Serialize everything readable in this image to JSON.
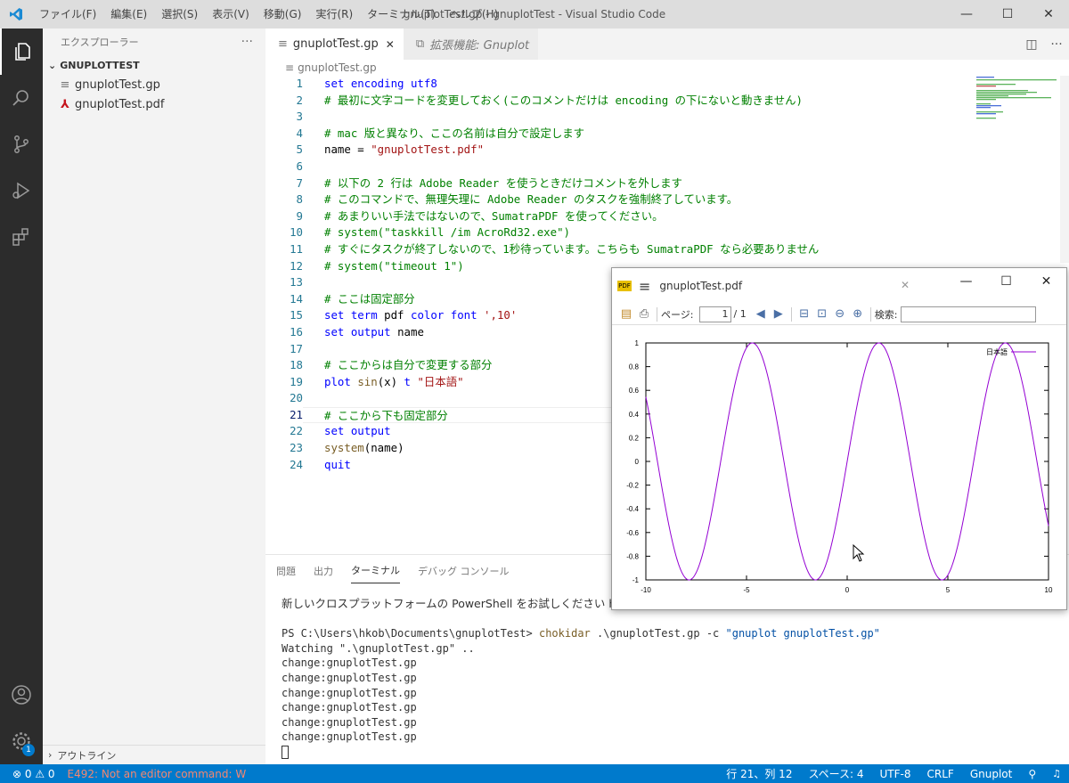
{
  "window": {
    "title": "gnuplotTest.gp - gnuplotTest - Visual Studio Code",
    "menu": [
      "ファイル(F)",
      "編集(E)",
      "選択(S)",
      "表示(V)",
      "移動(G)",
      "実行(R)",
      "ターミナル(T)",
      "ヘルプ(H)"
    ],
    "controls": {
      "minimize": "—",
      "maximize": "☐",
      "close": "✕"
    }
  },
  "activity": {
    "icons": [
      "files-icon",
      "search-icon",
      "source-control-icon",
      "run-debug-icon",
      "extensions-icon",
      "account-icon",
      "settings-gear-icon"
    ],
    "badge": "1"
  },
  "sidebar": {
    "title": "エクスプローラー",
    "more": "···",
    "folder": "GNUPLOTTEST",
    "files": [
      {
        "name": "gnuplotTest.gp",
        "icon": "≡"
      },
      {
        "name": "gnuplotTest.pdf",
        "icon": "⅄"
      }
    ],
    "outline": "アウトライン"
  },
  "tabs": [
    {
      "label": "gnuplotTest.gp",
      "close": "✕",
      "icon": "≡"
    },
    {
      "label": "拡張機能: Gnuplot",
      "icon": "⧉"
    }
  ],
  "breadcrumb": "gnuplotTest.gp",
  "code": {
    "current_line": 21,
    "lines": [
      [
        [
          "kw",
          "set encoding utf8"
        ]
      ],
      [
        [
          "cm",
          "# 最初に文字コードを変更しておく(このコメントだけは encoding の下にないと動きません)"
        ]
      ],
      [],
      [
        [
          "cm",
          "# mac 版と異なり、ここの名前は自分で設定します"
        ]
      ],
      [
        [
          "tx",
          "name = "
        ],
        [
          "st",
          "\"gnuplotTest.pdf\""
        ]
      ],
      [],
      [
        [
          "cm",
          "# 以下の 2 行は Adobe Reader を使うときだけコメントを外します"
        ]
      ],
      [
        [
          "cm",
          "# このコマンドで、無理矢理に Adobe Reader のタスクを強制終了しています。"
        ]
      ],
      [
        [
          "cm",
          "# あまりいい手法ではないので、SumatraPDF を使ってください。"
        ]
      ],
      [
        [
          "cm",
          "# system(\"taskkill /im AcroRd32.exe\")"
        ]
      ],
      [
        [
          "cm",
          "# すぐにタスクが終了しないので、1秒待っています。こちらも SumatraPDF なら必要ありません"
        ]
      ],
      [
        [
          "cm",
          "# system(\"timeout 1\")"
        ]
      ],
      [],
      [
        [
          "cm",
          "# ここは固定部分"
        ]
      ],
      [
        [
          "kw",
          "set term "
        ],
        [
          "tx",
          "pdf "
        ],
        [
          "kw",
          "color font "
        ],
        [
          "st",
          "',10'"
        ]
      ],
      [
        [
          "kw",
          "set output "
        ],
        [
          "tx",
          "name"
        ]
      ],
      [],
      [
        [
          "cm",
          "# ここからは自分で変更する部分"
        ]
      ],
      [
        [
          "kw",
          "plot "
        ],
        [
          "fn",
          "sin"
        ],
        [
          "tx",
          "(x) "
        ],
        [
          "kw",
          "t "
        ],
        [
          "st",
          "\"日本語\""
        ]
      ],
      [],
      [
        [
          "cm",
          "# ここから下も固定部分"
        ]
      ],
      [
        [
          "kw",
          "set output"
        ]
      ],
      [
        [
          "fn",
          "system"
        ],
        [
          "tx",
          "(name)"
        ]
      ],
      [
        [
          "kw",
          "quit"
        ]
      ]
    ]
  },
  "panel": {
    "tabs": [
      "問題",
      "出力",
      "ターミナル",
      "デバッグ コンソール"
    ],
    "active_tab": 2,
    "terminal": {
      "line1": "新しいクロスプラットフォームの PowerShell をお試しください https://aka.ms/pscore6",
      "prompt": "PS C:\\Users\\hkob\\Documents\\gnuplotTest> ",
      "cmd": "chokidar",
      "args": " .\\gnuplotTest.gp -c ",
      "str": "\"gnuplot gnuplotTest.gp\"",
      "watching": "Watching \".\\gnuplotTest.gp\" ..",
      "changes": [
        "change:gnuplotTest.gp",
        "change:gnuplotTest.gp",
        "change:gnuplotTest.gp",
        "change:gnuplotTest.gp",
        "change:gnuplotTest.gp",
        "change:gnuplotTest.gp"
      ]
    }
  },
  "statusbar": {
    "errors": "⊗ 0 ⚠ 0",
    "message": "E492: Not an editor command: W",
    "position": "行 21、列 12",
    "spaces": "スペース: 4",
    "encoding": "UTF-8",
    "eol": "CRLF",
    "language": "Gnuplot",
    "feedback_icon": "⚲",
    "bell_icon": "🔔"
  },
  "pdf_viewer": {
    "title": "gnuplotTest.pdf",
    "logo": "PDF",
    "menu": "≡",
    "tab_close": "✕",
    "controls": {
      "minimize": "—",
      "maximize": "☐",
      "close": "✕"
    },
    "page_label": "ページ:",
    "page_value": "1",
    "page_total": "/ 1",
    "search_label": "検索:"
  },
  "chart_data": {
    "type": "line",
    "series": [
      {
        "name": "日本語",
        "function": "sin(x)",
        "color": "#9400d3"
      }
    ],
    "xlim": [
      -10,
      10
    ],
    "ylim": [
      -1,
      1
    ],
    "xticks": [
      "-10",
      "-5",
      "0",
      "5",
      "10"
    ],
    "yticks": [
      "1",
      "0.8",
      "0.6",
      "0.4",
      "0.2",
      "0",
      "-0.2",
      "-0.4",
      "-0.6",
      "-0.8",
      "-1"
    ],
    "legend_placement": "top-right",
    "grid": false
  }
}
